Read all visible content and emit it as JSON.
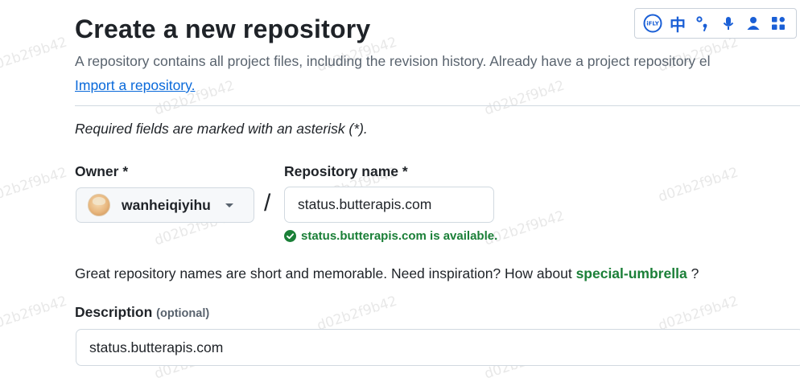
{
  "page": {
    "title": "Create a new repository",
    "subtitle": "A repository contains all project files, including the revision history. Already have a project repository el",
    "import_link": "Import a repository.",
    "required_note": "Required fields are marked with an asterisk (*)."
  },
  "owner": {
    "label": "Owner *",
    "selected": "wanheiqiyihu"
  },
  "repository": {
    "label": "Repository name *",
    "value": "status.butterapis.com",
    "availability": "status.butterapis.com is available."
  },
  "separator": "/",
  "hint": {
    "text": "Great repository names are short and memorable. Need inspiration? How about",
    "suggestion": "special-umbrella",
    "suffix": "?"
  },
  "description": {
    "label": "Description",
    "optional": "(optional)",
    "value": "status.butterapis.com"
  },
  "ime_toolbar": {
    "logo": "iFLY",
    "lang": "中"
  },
  "watermark": "d02b2f9b42",
  "colors": {
    "link": "#0969da",
    "success": "#1a7f37",
    "toolbar_icon": "#1a5fd6"
  }
}
